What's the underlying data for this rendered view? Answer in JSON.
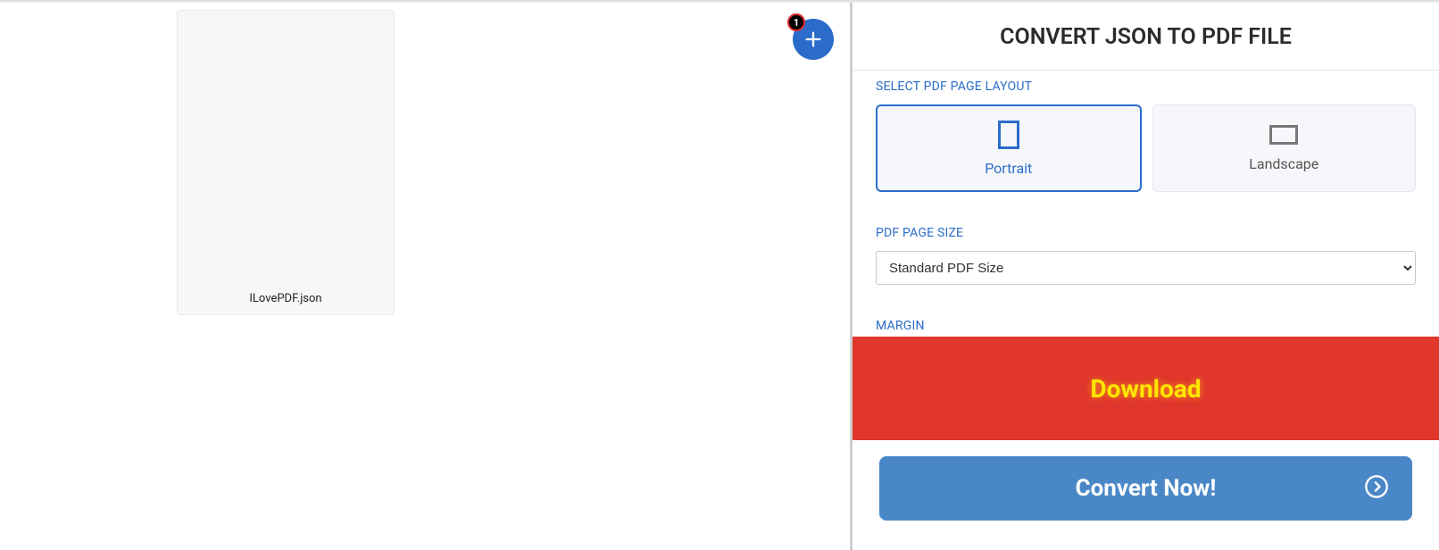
{
  "left": {
    "file_name": "ILovePDF.json",
    "add_badge": "1"
  },
  "right": {
    "title": "CONVERT JSON TO PDF FILE",
    "layout_section_label": "SELECT PDF PAGE LAYOUT",
    "layout_options": {
      "portrait": "Portrait",
      "landscape": "Landscape"
    },
    "page_size_section_label": "PDF PAGE SIZE",
    "page_size_selected": "Standard PDF Size",
    "margin_section_label": "MARGIN",
    "download_label": "Download",
    "convert_label": "Convert Now!"
  }
}
